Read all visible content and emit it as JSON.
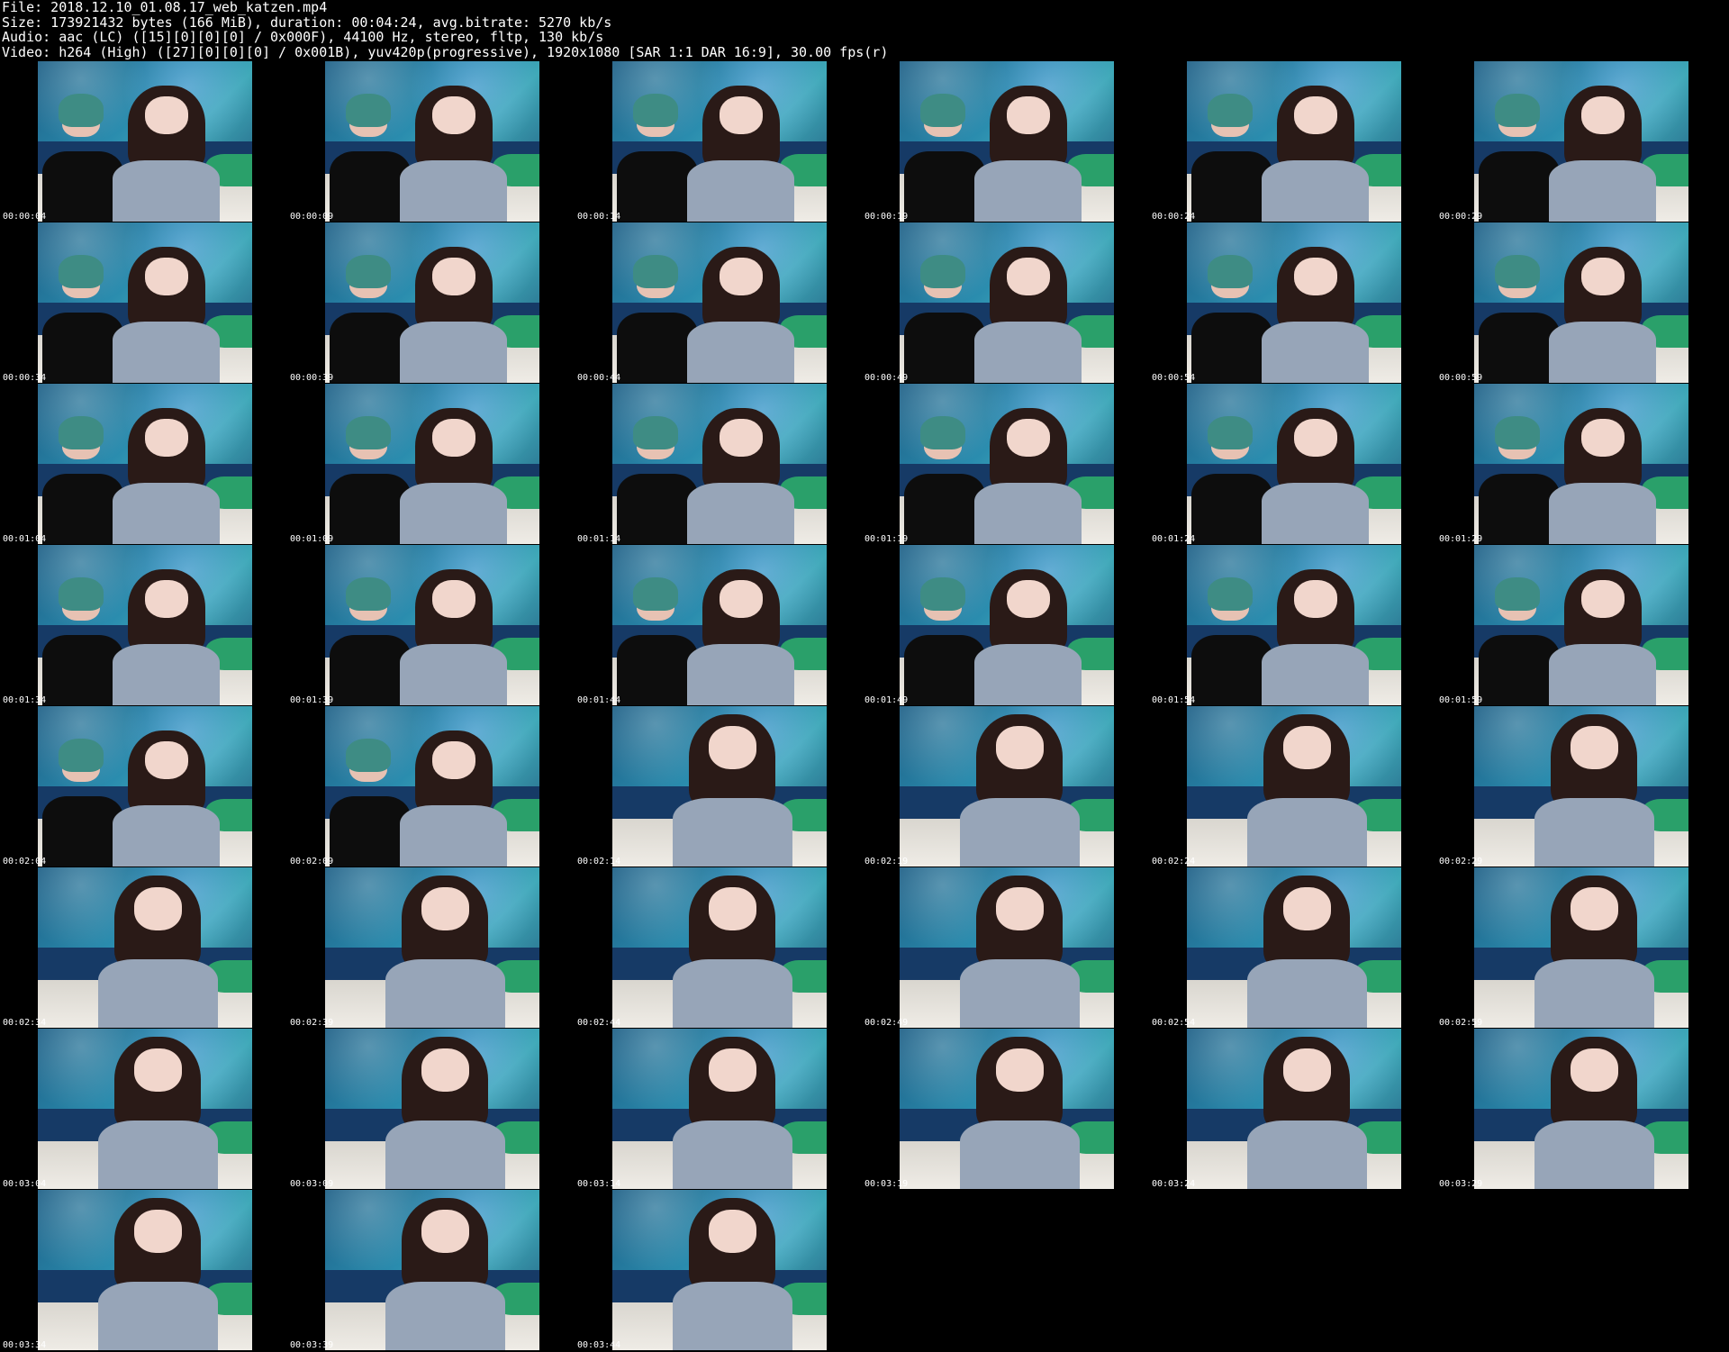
{
  "header": {
    "file_line": "File: 2018.12.10_01.08.17_web_katzen.mp4",
    "size_line": "Size: 173921432 bytes (166 MiB), duration: 00:04:24, avg.bitrate: 5270 kb/s",
    "audio_line": "Audio: aac (LC) ([15][0][0][0] / 0x000F), 44100 Hz, stereo, fltp, 130 kb/s",
    "video_line": "Video: h264 (High) ([27][0][0][0] / 0x001B), yuv420p(progressive), 1920x1080 [SAR 1:1 DAR 16:9], 30.00 fps(r)"
  },
  "thumbnails": [
    {
      "time": "00:00:04",
      "friend": true
    },
    {
      "time": "00:00:09",
      "friend": true
    },
    {
      "time": "00:00:14",
      "friend": true
    },
    {
      "time": "00:00:19",
      "friend": true
    },
    {
      "time": "00:00:24",
      "friend": true
    },
    {
      "time": "00:00:29",
      "friend": true
    },
    {
      "time": "00:00:34",
      "friend": true
    },
    {
      "time": "00:00:39",
      "friend": true
    },
    {
      "time": "00:00:44",
      "friend": true
    },
    {
      "time": "00:00:49",
      "friend": true
    },
    {
      "time": "00:00:54",
      "friend": true
    },
    {
      "time": "00:00:59",
      "friend": true
    },
    {
      "time": "00:01:04",
      "friend": true
    },
    {
      "time": "00:01:09",
      "friend": true
    },
    {
      "time": "00:01:14",
      "friend": true
    },
    {
      "time": "00:01:19",
      "friend": true
    },
    {
      "time": "00:01:24",
      "friend": true
    },
    {
      "time": "00:01:29",
      "friend": true
    },
    {
      "time": "00:01:34",
      "friend": true
    },
    {
      "time": "00:01:39",
      "friend": true
    },
    {
      "time": "00:01:44",
      "friend": true
    },
    {
      "time": "00:01:49",
      "friend": true
    },
    {
      "time": "00:01:54",
      "friend": true
    },
    {
      "time": "00:01:59",
      "friend": true
    },
    {
      "time": "00:02:04",
      "friend": true
    },
    {
      "time": "00:02:09",
      "friend": true
    },
    {
      "time": "00:02:14",
      "friend": false
    },
    {
      "time": "00:02:19",
      "friend": false
    },
    {
      "time": "00:02:24",
      "friend": false
    },
    {
      "time": "00:02:29",
      "friend": false
    },
    {
      "time": "00:02:34",
      "friend": false
    },
    {
      "time": "00:02:39",
      "friend": false
    },
    {
      "time": "00:02:44",
      "friend": false
    },
    {
      "time": "00:02:49",
      "friend": false
    },
    {
      "time": "00:02:54",
      "friend": false
    },
    {
      "time": "00:02:59",
      "friend": false
    },
    {
      "time": "00:03:04",
      "friend": false
    },
    {
      "time": "00:03:09",
      "friend": false
    },
    {
      "time": "00:03:14",
      "friend": false
    },
    {
      "time": "00:03:19",
      "friend": false
    },
    {
      "time": "00:03:24",
      "friend": false
    },
    {
      "time": "00:03:29",
      "friend": false
    },
    {
      "time": "00:03:34",
      "friend": false
    },
    {
      "time": "00:03:39",
      "friend": false
    },
    {
      "time": "00:03:44",
      "friend": false
    }
  ],
  "colors": {
    "background": "#000000",
    "text": "#ffffff"
  }
}
